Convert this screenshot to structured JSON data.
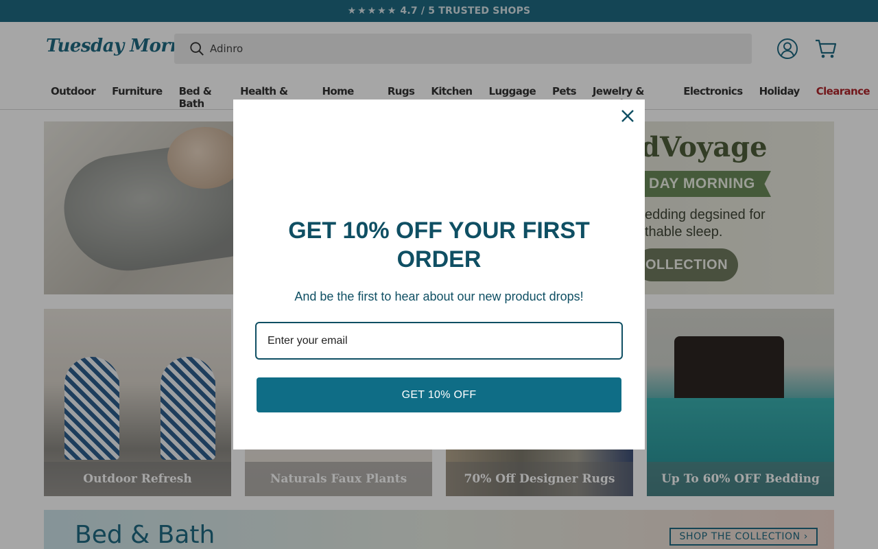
{
  "topbar": {
    "stars": "★★★★★",
    "rating_text": "4.7 / 5 TRUSTED SHOPS"
  },
  "header": {
    "logo": "Tuesday Morning",
    "search": {
      "value": "Adinro",
      "placeholder": ""
    }
  },
  "nav": {
    "items": [
      "Outdoor",
      "Furniture",
      "Bed & Bath",
      "Health & Beauty",
      "Home Decor",
      "Rugs",
      "Kitchen",
      "Luggage",
      "Pets",
      "Jewelry & Watches",
      "Electronics",
      "Holiday"
    ],
    "clearance": "Clearance"
  },
  "hero": {
    "brand": "dVoyage",
    "ribbon": "DAY MORNING",
    "copy_line1": "edding degsined for",
    "copy_line2": "thable sleep.",
    "button": "OLLECTION"
  },
  "tiles": [
    {
      "caption": "Outdoor Refresh"
    },
    {
      "caption": "Naturals Faux Plants"
    },
    {
      "caption": "70% Off Designer Rugs"
    },
    {
      "caption": "Up To 60% OFF Bedding"
    }
  ],
  "banner": {
    "title": "Bed & Bath",
    "cta": "SHOP THE COLLECTION ›"
  },
  "modal": {
    "headline": "GET 10% OFF YOUR FIRST ORDER",
    "subtext": "And be the first to hear about our new product drops!",
    "email_placeholder": "Enter your email",
    "button": "GET 10% OFF"
  },
  "colors": {
    "brand": "#1f6a83",
    "modal_text": "#0f4f63",
    "cta": "#0f6d86",
    "clearance": "#b0252c"
  }
}
